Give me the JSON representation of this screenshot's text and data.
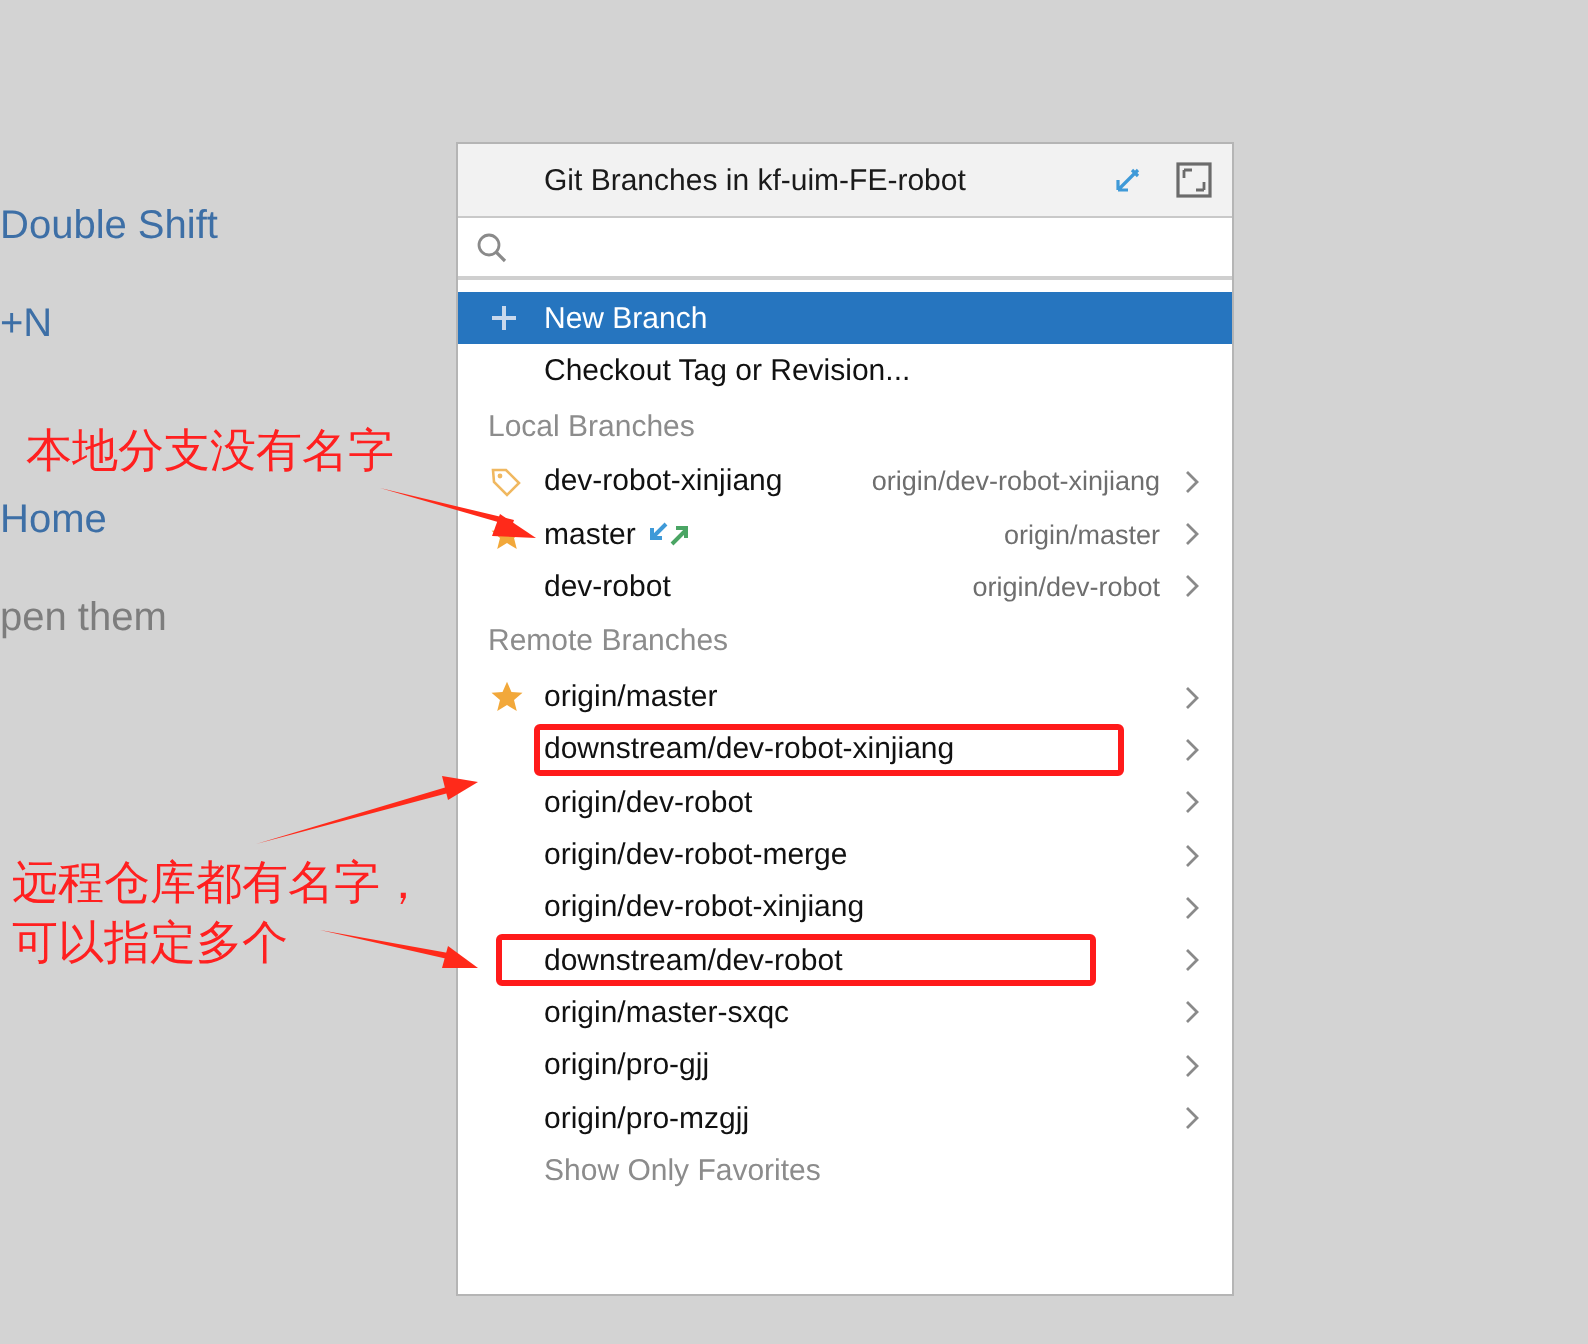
{
  "hints": [
    {
      "text": "Double Shift",
      "kind": "shortcut"
    },
    {
      "text": "+N",
      "kind": "shortcut"
    },
    {
      "text": "Home",
      "kind": "shortcut"
    },
    {
      "text": "pen them",
      "kind": "note"
    }
  ],
  "popup": {
    "title": "Git Branches in kf-uim-FE-robot",
    "items": [
      {
        "kind": "action",
        "name": "New Branch",
        "selected": true
      },
      {
        "kind": "action",
        "name": "Checkout Tag or Revision...",
        "selected": false
      },
      {
        "kind": "header",
        "name": "Local Branches"
      },
      {
        "kind": "branch",
        "name": "dev-robot-xinjiang",
        "tracking": "origin/dev-robot-xinjiang",
        "current": true,
        "favorite": false,
        "has_updates": false,
        "highlighted": false,
        "selected": false
      },
      {
        "kind": "branch",
        "name": "master",
        "tracking": "origin/master",
        "current": false,
        "favorite": true,
        "has_updates": true,
        "highlighted": false,
        "selected": false
      },
      {
        "kind": "branch",
        "name": "dev-robot",
        "tracking": "origin/dev-robot",
        "current": false,
        "favorite": false,
        "has_updates": false,
        "highlighted": false,
        "selected": false
      },
      {
        "kind": "header",
        "name": "Remote Branches"
      },
      {
        "kind": "branch",
        "name": "origin/master",
        "current": false,
        "favorite": true,
        "has_updates": false,
        "highlighted": false,
        "selected": false
      },
      {
        "kind": "branch",
        "name": "downstream/dev-robot-xinjiang",
        "current": false,
        "favorite": false,
        "has_updates": false,
        "highlighted": true,
        "selected": false
      },
      {
        "kind": "branch",
        "name": "origin/dev-robot",
        "current": false,
        "favorite": false,
        "has_updates": false,
        "highlighted": false,
        "selected": false
      },
      {
        "kind": "branch",
        "name": "origin/dev-robot-merge",
        "current": false,
        "favorite": false,
        "has_updates": false,
        "highlighted": false,
        "selected": false
      },
      {
        "kind": "branch",
        "name": "origin/dev-robot-xinjiang",
        "current": false,
        "favorite": false,
        "has_updates": false,
        "highlighted": false,
        "selected": false
      },
      {
        "kind": "branch",
        "name": "downstream/dev-robot",
        "current": false,
        "favorite": false,
        "has_updates": false,
        "highlighted": true,
        "selected": false
      },
      {
        "kind": "branch",
        "name": "origin/master-sxqc",
        "current": false,
        "favorite": false,
        "has_updates": false,
        "highlighted": false,
        "selected": false
      },
      {
        "kind": "branch",
        "name": "origin/pro-gjj",
        "current": false,
        "favorite": false,
        "has_updates": false,
        "highlighted": false,
        "selected": false
      },
      {
        "kind": "branch",
        "name": "origin/pro-mzgjj",
        "current": false,
        "favorite": false,
        "has_updates": false,
        "highlighted": false,
        "selected": false
      },
      {
        "kind": "link",
        "name": "Show Only Favorites",
        "selected": false
      }
    ]
  },
  "annotations": [
    {
      "lines": [
        "本地分支没有名字"
      ]
    },
    {
      "lines": [
        "远程仓库都有名字，",
        "可以指定多个"
      ]
    }
  ]
}
